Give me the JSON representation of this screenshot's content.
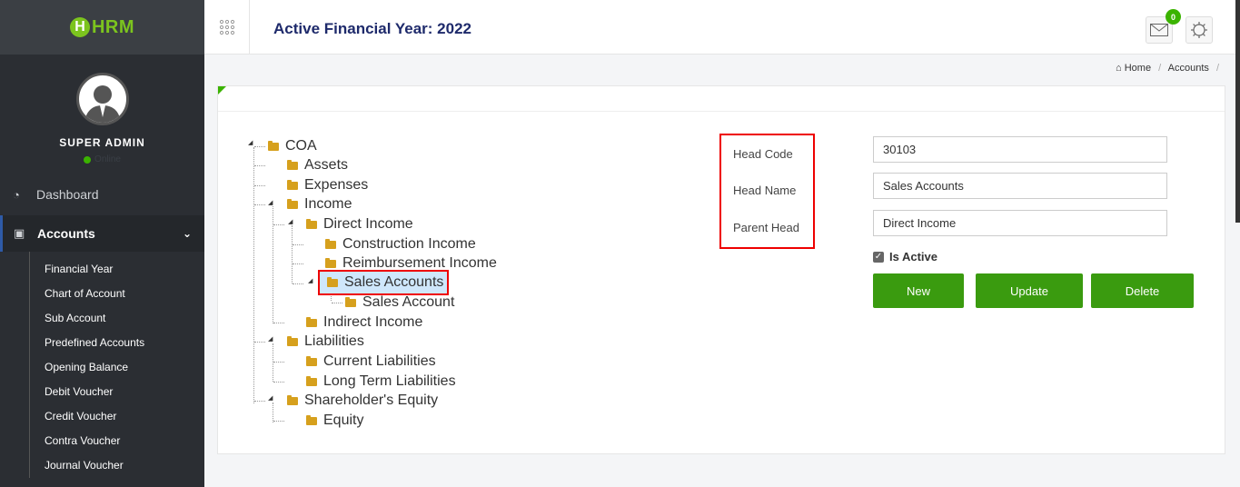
{
  "app": {
    "logo_letter": "H",
    "logo_text": "HRM"
  },
  "user": {
    "name": "SUPER ADMIN",
    "status": "Online"
  },
  "sidebar": {
    "dashboard_label": "Dashboard",
    "accounts_label": "Accounts",
    "sub_items": [
      "Financial Year",
      "Chart of Account",
      "Sub Account",
      "Predefined Accounts",
      "Opening Balance",
      "Debit Voucher",
      "Credit Voucher",
      "Contra Voucher",
      "Journal Voucher"
    ]
  },
  "header": {
    "title": "Active Financial Year: 2022",
    "mail_badge": "0"
  },
  "breadcrumb": {
    "home": "Home",
    "current": "Accounts"
  },
  "tree": {
    "root": "COA",
    "nodes": [
      "Assets",
      "Expenses",
      "Income",
      "Direct Income",
      "Construction Income",
      "Reimbursement Income",
      "Sales Accounts",
      "Sales Account",
      "Indirect Income",
      "Liabilities",
      "Current Liabilities",
      "Long Term Liabilities",
      "Shareholder's Equity",
      "Equity"
    ],
    "selected": "Sales Accounts"
  },
  "form": {
    "head_code_label": "Head Code",
    "head_name_label": "Head Name",
    "parent_head_label": "Parent Head",
    "head_code": "30103",
    "head_name": "Sales Accounts",
    "parent_head": "Direct Income",
    "is_active_label": "Is Active",
    "new_label": "New",
    "update_label": "Update",
    "delete_label": "Delete"
  },
  "colors": {
    "accent_green": "#3a9b0f",
    "sidebar_bg": "#2b2e33",
    "title_navy": "#1e2a6b",
    "highlight_red": "#e00000"
  }
}
